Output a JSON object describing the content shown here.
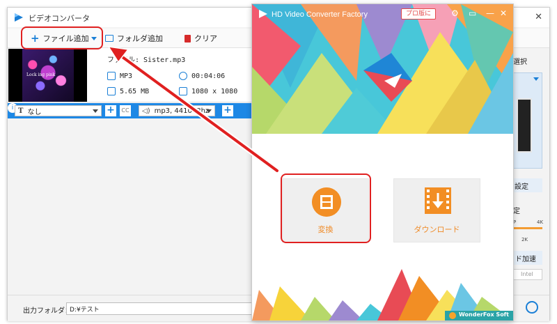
{
  "back_window": {
    "title": "ビデオコンバータ",
    "close_glyph": "✕",
    "toolbar": {
      "add_file_label": "ファイル追加",
      "add_folder_label": "フォルダ追加",
      "clear_label": "クリア"
    },
    "file": {
      "name_line": "ファイル: Sister.mp3",
      "thumbnail_text": "Lock ing pink",
      "format": "MP3",
      "duration": "00:04:06",
      "size": "5.65 MB",
      "resolution": "1080 x 1080"
    },
    "options_bar": {
      "subtitle_value": "なし",
      "cc_label": "CC",
      "audio_value": "mp3, 441048hz"
    },
    "bottom": {
      "output_label": "出力フォルダ：",
      "output_path": "D:¥テスト"
    },
    "side_panel": {
      "select_label": "選択",
      "settings_label": "設定",
      "quality_label": "定",
      "p_label": "P",
      "k4_label": "4K",
      "k2_label": "2K",
      "gpu_label": "ド加速",
      "intel_label": "Intel"
    }
  },
  "front_window": {
    "title": "HD Video Converter Factory",
    "pro_badge": "プロ版に",
    "convert_label": "変換",
    "download_label": "ダウンロード",
    "brand": "WonderFox Soft"
  },
  "colors": {
    "accent_blue": "#1e88e5",
    "accent_orange": "#f28e24",
    "annotation_red": "#e02020"
  }
}
